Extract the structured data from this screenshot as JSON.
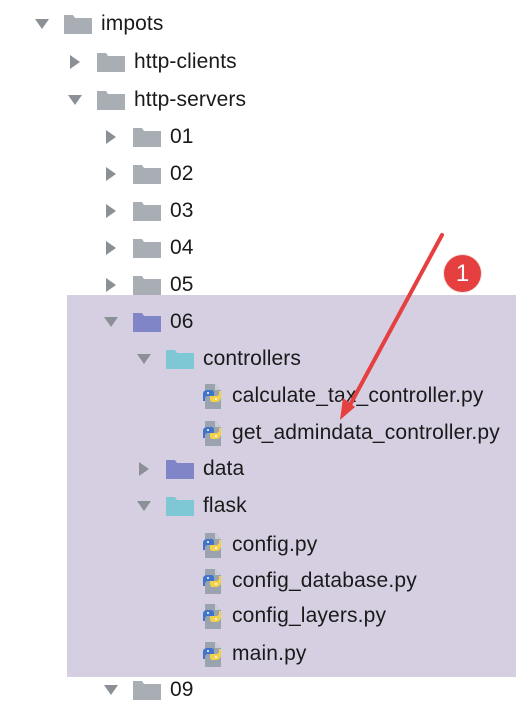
{
  "tree": {
    "items": [
      {
        "label": "impots",
        "type": "folder",
        "expanded": true,
        "icon": "folder-icon",
        "color": "#a8aeb4"
      },
      {
        "label": "http-clients",
        "type": "folder",
        "expanded": false,
        "icon": "folder-icon",
        "color": "#a8aeb4"
      },
      {
        "label": "http-servers",
        "type": "folder",
        "expanded": true,
        "icon": "folder-icon",
        "color": "#a8aeb4"
      },
      {
        "label": "01",
        "type": "folder",
        "expanded": false,
        "icon": "folder-icon",
        "color": "#a8aeb4"
      },
      {
        "label": "02",
        "type": "folder",
        "expanded": false,
        "icon": "folder-icon",
        "color": "#a8aeb4"
      },
      {
        "label": "03",
        "type": "folder",
        "expanded": false,
        "icon": "folder-icon",
        "color": "#a8aeb4"
      },
      {
        "label": "04",
        "type": "folder",
        "expanded": false,
        "icon": "folder-icon",
        "color": "#a8aeb4"
      },
      {
        "label": "05",
        "type": "folder",
        "expanded": false,
        "icon": "folder-icon",
        "color": "#a8aeb4"
      },
      {
        "label": "06",
        "type": "folder",
        "expanded": true,
        "icon": "folder-icon",
        "color": "#7f85c6",
        "selected": true
      },
      {
        "label": "controllers",
        "type": "folder",
        "expanded": true,
        "icon": "folder-icon",
        "color": "#7ec7d5"
      },
      {
        "label": "calculate_tax_controller.py",
        "type": "file",
        "icon": "python-file-icon"
      },
      {
        "label": "get_admindata_controller.py",
        "type": "file",
        "icon": "python-file-icon"
      },
      {
        "label": "data",
        "type": "folder",
        "expanded": false,
        "icon": "folder-icon",
        "color": "#7f85c6"
      },
      {
        "label": "flask",
        "type": "folder",
        "expanded": true,
        "icon": "folder-icon",
        "color": "#7ec7d5"
      },
      {
        "label": "config.py",
        "type": "file",
        "icon": "python-file-icon"
      },
      {
        "label": "config_database.py",
        "type": "file",
        "icon": "python-file-icon"
      },
      {
        "label": "config_layers.py",
        "type": "file",
        "icon": "python-file-icon"
      },
      {
        "label": "main.py",
        "type": "file",
        "icon": "python-file-icon"
      },
      {
        "label": "09",
        "type": "folder",
        "expanded": true,
        "icon": "folder-icon",
        "color": "#a8aeb4"
      }
    ]
  },
  "annotation": {
    "marker": "1",
    "color": "#e53f3f"
  },
  "colors": {
    "selection": "#d6cfe2",
    "text": "#1a1a1a",
    "toggle": "#8a9096"
  }
}
